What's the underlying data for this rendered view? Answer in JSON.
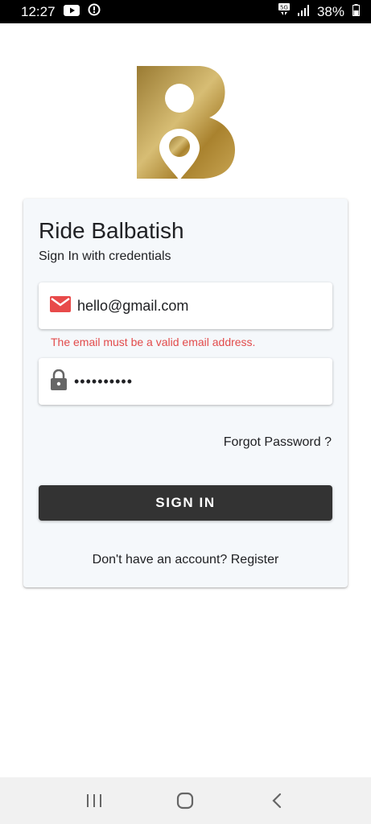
{
  "status_bar": {
    "time": "12:27",
    "battery": "38%"
  },
  "app": {
    "title": "Ride Balbatish",
    "subtitle": "Sign In with credentials",
    "brand_color": "#b28d3a"
  },
  "form": {
    "email_value": "hello@gmail.com",
    "email_error": "The email must be a valid email address.",
    "password_mask": "••••••••••",
    "forgot_label": "Forgot Password ?",
    "signin_label": "SIGN IN",
    "register_prefix": "Don't have an account? ",
    "register_link": "Register"
  },
  "icons": {
    "email": "mail-icon",
    "password": "lock-icon"
  },
  "colors": {
    "error": "#e24b4b",
    "button": "#333333",
    "mail_icon": "#e84a4a"
  }
}
